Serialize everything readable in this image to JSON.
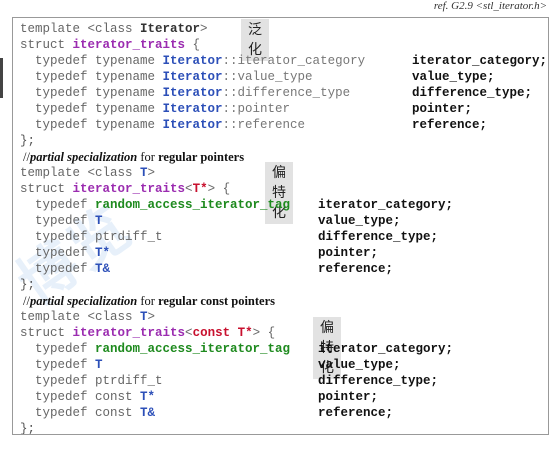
{
  "header": {
    "ref": "ref. G2.9 <stl_iterator.h>"
  },
  "block1": {
    "line1": {
      "kw": "template <class ",
      "param": "Iterator",
      "close": ">"
    },
    "line2": {
      "kw": "struct ",
      "name": "iterator_traits",
      "brace": " {"
    },
    "rows": [
      {
        "pre": "  typedef typename ",
        "param": "Iterator",
        "member": "::iterator_category",
        "right": "iterator_category;"
      },
      {
        "pre": "  typedef typename ",
        "param": "Iterator",
        "member": "::value_type",
        "right": "value_type;"
      },
      {
        "pre": "  typedef typename ",
        "param": "Iterator",
        "member": "::difference_type",
        "right": "difference_type;"
      },
      {
        "pre": "  typedef typename ",
        "param": "Iterator",
        "member": "::pointer",
        "right": "pointer;"
      },
      {
        "pre": "  typedef typename ",
        "param": "Iterator",
        "member": "::reference",
        "right": "reference;"
      }
    ],
    "end": "};",
    "tag": "泛化"
  },
  "note2": {
    "slashes": "//",
    "italic": "partial specialization",
    "plain": " for ",
    "bold": "regular pointers"
  },
  "block2": {
    "line1": {
      "kw": "template <class ",
      "param": "T",
      "close": ">"
    },
    "line2": {
      "kw": "struct ",
      "name": "iterator_traits",
      "open": "<",
      "spec": "T*",
      "close": ">",
      "brace": " {"
    },
    "rows": [
      {
        "pre": "  typedef ",
        "green": "random_access_iterator_tag",
        "mid": "",
        "right": "iterator_category;"
      },
      {
        "pre": "  typedef ",
        "green": "",
        "mid": "T",
        "right": "value_type;"
      },
      {
        "pre": "  typedef ptrdiff_t",
        "green": "",
        "mid": "",
        "right": "difference_type;"
      },
      {
        "pre": "  typedef ",
        "green": "",
        "mid": "T*",
        "right": "pointer;"
      },
      {
        "pre": "  typedef ",
        "green": "",
        "mid": "T&",
        "right": "reference;"
      }
    ],
    "end": "};",
    "tag": "偏特化"
  },
  "note3": {
    "slashes": "//",
    "italic": "partial specialization",
    "plain": " for ",
    "bold": "regular const pointers"
  },
  "block3": {
    "line1": {
      "kw": "template <class ",
      "param": "T",
      "close": ">"
    },
    "line2": {
      "kw": "struct ",
      "name": "iterator_traits",
      "open": "<",
      "spec": "const T*",
      "close": ">",
      "brace": " {"
    },
    "rows": [
      {
        "pre": "  typedef ",
        "green": "random_access_iterator_tag",
        "mid": "",
        "right": "iterator_category;"
      },
      {
        "pre": "  typedef ",
        "green": "",
        "mid": "T",
        "right": "value_type;"
      },
      {
        "pre": "  typedef ptrdiff_t",
        "green": "",
        "mid": "",
        "right": "difference_type;"
      },
      {
        "pre": "  typedef const ",
        "green": "",
        "mid": "T*",
        "right": "pointer;"
      },
      {
        "pre": "  typedef const ",
        "green": "",
        "mid": "T&",
        "right": "reference;"
      }
    ],
    "end": "};",
    "tag": "偏特化"
  },
  "colors": {
    "param": "#2c4fb8",
    "trait": "#9b2cb0",
    "spec": "#c8102e",
    "tag_green": "#1e8a1e"
  }
}
